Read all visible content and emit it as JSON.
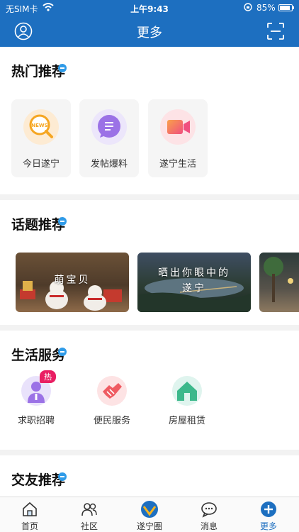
{
  "status": {
    "carrier": "无SIM卡",
    "time": "上午9:43",
    "battery": "85%"
  },
  "header": {
    "title": "更多",
    "left_icon": "profile-icon",
    "right_icon": "scan-icon"
  },
  "hot": {
    "title": "热门推荐",
    "items": [
      {
        "label": "今日遂宁",
        "icon": "news-icon",
        "badge": "NEWS"
      },
      {
        "label": "发帖爆料",
        "icon": "post-icon"
      },
      {
        "label": "遂宁生活",
        "icon": "video-icon"
      }
    ]
  },
  "topics": {
    "title": "话题推荐",
    "items": [
      {
        "label": "萌宝贝"
      },
      {
        "label_line1": "晒出你眼中的",
        "label_line2": "遂宁"
      },
      {
        "label": ""
      }
    ]
  },
  "services": {
    "title": "生活服务",
    "items": [
      {
        "label": "求职招聘",
        "badge": "热",
        "icon": "job-icon"
      },
      {
        "label": "便民服务",
        "icon": "handshake-icon"
      },
      {
        "label": "房屋租赁",
        "icon": "house-icon"
      }
    ]
  },
  "friends": {
    "title": "交友推荐"
  },
  "tabs": [
    {
      "label": "首页",
      "icon": "home-icon"
    },
    {
      "label": "社区",
      "icon": "community-icon"
    },
    {
      "label": "遂宁圈",
      "icon": "circle-logo-icon"
    },
    {
      "label": "消息",
      "icon": "message-icon"
    },
    {
      "label": "更多",
      "icon": "plus-icon",
      "active": true
    }
  ],
  "colors": {
    "brand": "#1d6fc0",
    "hot_badge": "#e91e63"
  }
}
